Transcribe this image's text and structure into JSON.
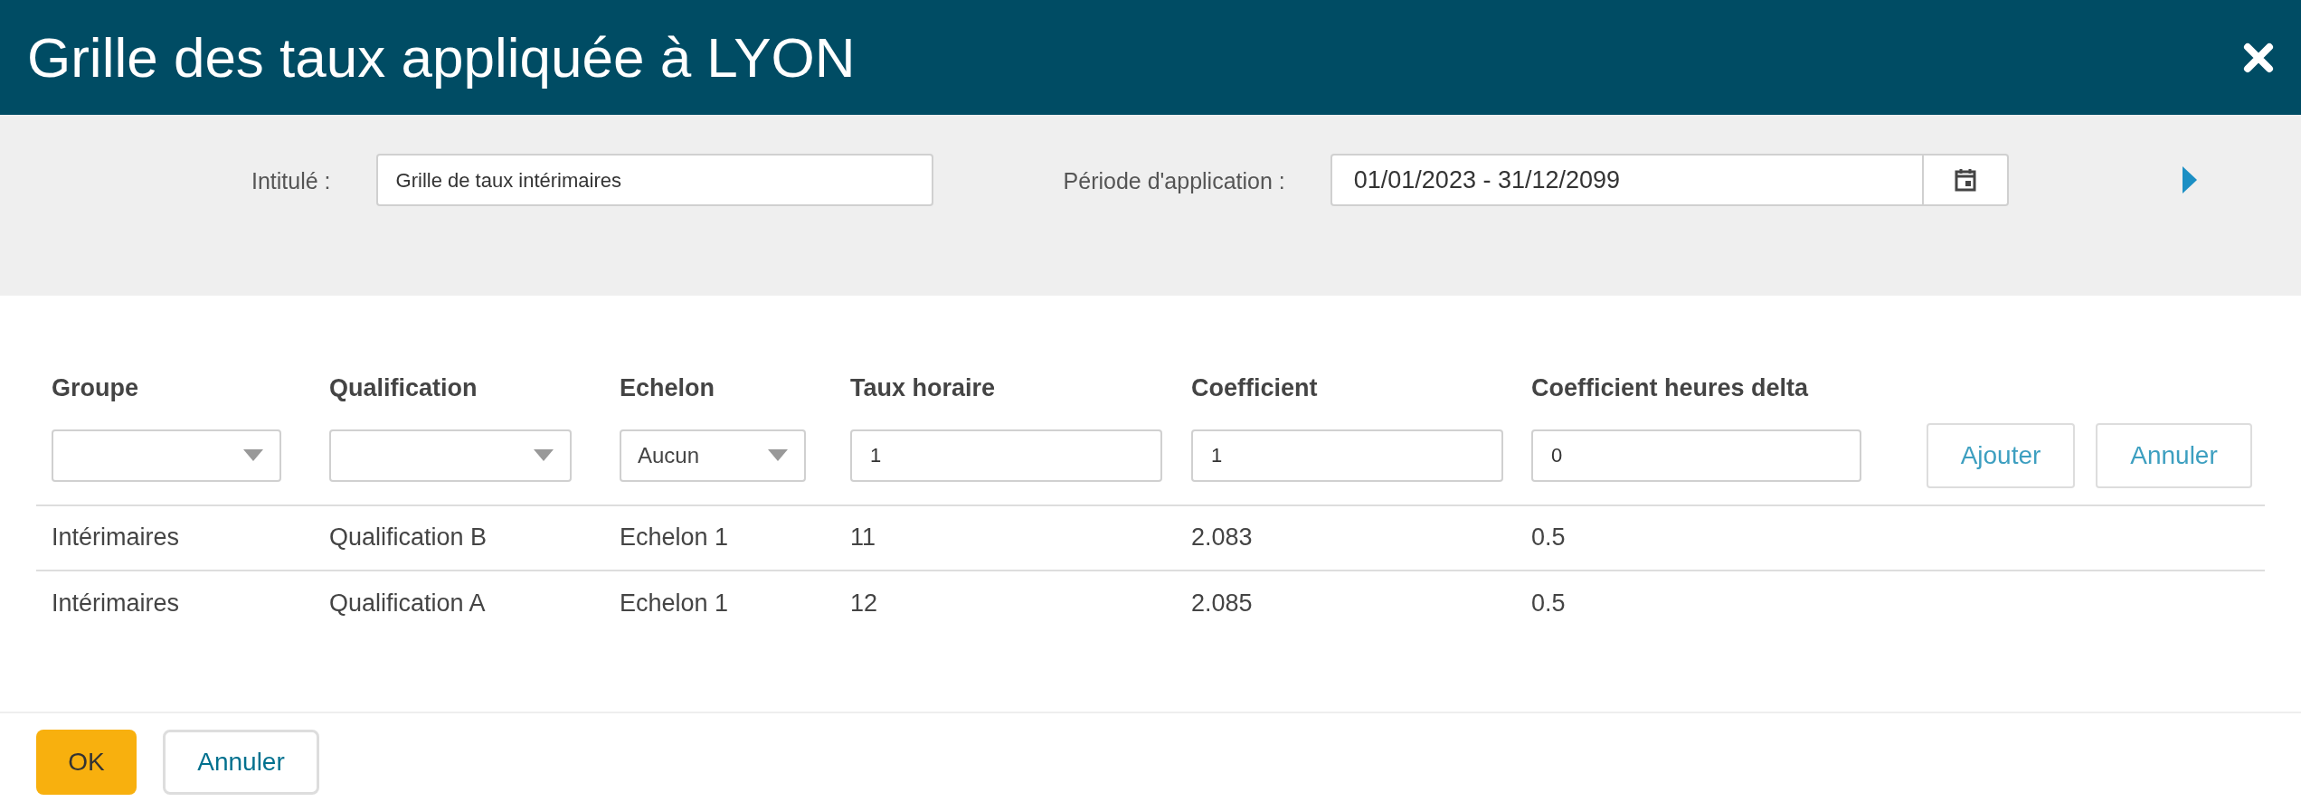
{
  "window": {
    "title": "Grille des taux appliquée à LYON"
  },
  "form": {
    "title_label": "Intitulé :",
    "title_value": "Grille de taux intérimaires",
    "period_label": "Période d'application :",
    "period_value": "01/01/2023 - 31/12/2099"
  },
  "table": {
    "columns": [
      "Groupe",
      "Qualification",
      "Echelon",
      "Taux horaire",
      "Coefficient",
      "Coefficient heures delta"
    ],
    "filters": [
      {
        "kind": "select"
      },
      {
        "kind": "select"
      },
      {
        "kind": "select",
        "value": "Aucun"
      },
      {
        "kind": "input",
        "value": "1"
      },
      {
        "kind": "input",
        "value": "1"
      },
      {
        "kind": "input",
        "value": "0"
      }
    ],
    "actions": [
      "Ajouter",
      "Annuler"
    ],
    "rows": [
      [
        "Intérimaires",
        "Qualification B",
        "Echelon 1",
        "11",
        "2.083",
        "0.5"
      ],
      [
        "Intérimaires",
        "Qualification A",
        "Echelon 1",
        "12",
        "2.085",
        "0.5"
      ]
    ]
  },
  "footer": {
    "ok": "OK",
    "cancel": "Annuler"
  }
}
